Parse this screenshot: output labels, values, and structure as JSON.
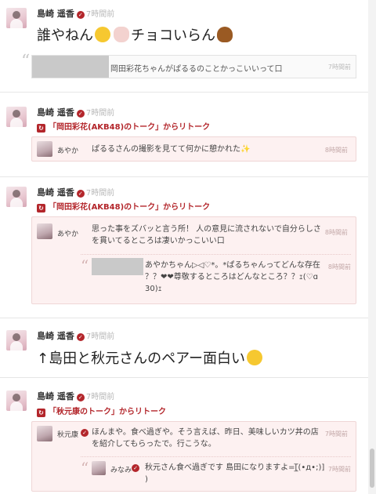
{
  "colors": {
    "accent": "#b3262b",
    "muted": "#b8b8b8",
    "rt_bg": "#fdf1f1",
    "rt_border": "#efd6d6"
  },
  "icons": {
    "verified": "verified-check-icon",
    "retalk": "retalk-icon",
    "quote": "quote-icon"
  },
  "posts": [
    {
      "author": "島崎 遥香",
      "time": "7時間前",
      "text_parts": [
        "誰やねん",
        "チョコいらん"
      ],
      "quote": {
        "text": "岡田彩花ちゃんがぱるるのことかっこいいって口",
        "time": "7時間前"
      }
    },
    {
      "author": "島崎 遥香",
      "time": "7時間前",
      "retalk": "「岡田彩花(AKB48)のトーク」からリトーク",
      "messages": [
        {
          "name": "あやか",
          "text": "ぱるるさんの撮影を見てて何かに憩かれた",
          "emoji": "✨",
          "time": "8時間前"
        }
      ]
    },
    {
      "author": "島崎 遥香",
      "time": "7時間前",
      "retalk": "「岡田彩花(AKB48)のトーク」からリトーク",
      "messages": [
        {
          "name": "あやか",
          "text_lines": [
            "思った事をズバッと言う所！ 人の意見に流されないで自分らしさ",
            "を貫いてるところは凄いかっこいい口"
          ],
          "time": "8時間前"
        }
      ],
      "inner_quote": {
        "text_lines": [
          "あやかちゃん▷◁♡*。*ぱるちゃんってどんな存在",
          "？？❤❤尊敬するところはどんなところ？？ｪ(♡ɑ",
          "30)ｪ"
        ],
        "time": "8時間前"
      }
    },
    {
      "author": "島崎 遥香",
      "time": "7時間前",
      "text": "↑島田と秋元さんのペアー面白い"
    },
    {
      "author": "島崎 遥香",
      "time": "7時間前",
      "retalk": "「秋元康のトーク」からリトーク",
      "messages": [
        {
          "name": "秋元康",
          "text_lines": [
            "ほんまや。食べ過ぎや。そう言えば、昨日、美味しいカツ丼の店",
            "を紹介してもらったで。行こうな。"
          ],
          "time": "7時間前"
        }
      ],
      "inner_quote": {
        "name": "みなみ",
        "text_lines": [
          "秋元さん食べ過ぎです 島田になりますよ=[̲̅(•д•;)]",
          ")"
        ],
        "time": "7時間前"
      }
    }
  ]
}
